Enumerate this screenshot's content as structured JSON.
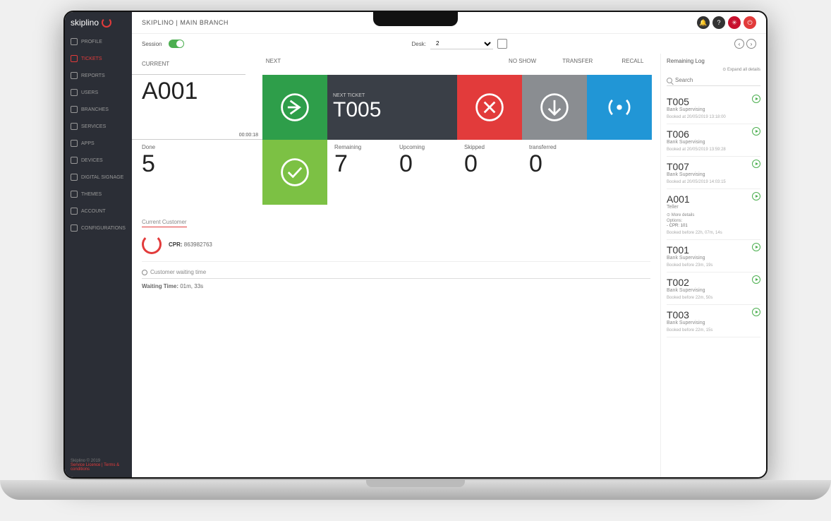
{
  "brand": "skiplino",
  "breadcrumb": "SKIPLINO | MAIN BRANCH",
  "sidebar": {
    "items": [
      {
        "label": "PROFILE"
      },
      {
        "label": "TICKETS"
      },
      {
        "label": "REPORTS"
      },
      {
        "label": "USERS"
      },
      {
        "label": "BRANCHES"
      },
      {
        "label": "SERVICES"
      },
      {
        "label": "APPS"
      },
      {
        "label": "DEVICES"
      },
      {
        "label": "DIGITAL SIGNAGE"
      },
      {
        "label": "THEMES"
      },
      {
        "label": "ACCOUNT"
      },
      {
        "label": "CONFIGURATIONS"
      }
    ],
    "footer": "Skiplino © 2019",
    "footer_links": "Service Licence | Terms & conditions"
  },
  "session": {
    "label": "Session",
    "desk_label": "Desk:",
    "desk_value": "2"
  },
  "headers": {
    "current": "CURRENT",
    "next": "NEXT",
    "noshow": "NO SHOW",
    "transfer": "TRANSFER",
    "recall": "RECALL",
    "next_ticket": "NEXT TICKET"
  },
  "current": {
    "value": "A001",
    "timer": "00:00:18"
  },
  "next_ticket": "T005",
  "stats": {
    "done_label": "Done",
    "done": "5",
    "remaining_label": "Remaining",
    "remaining": "7",
    "upcoming_label": "Upcoming",
    "upcoming": "0",
    "skipped_label": "Skipped",
    "skipped": "0",
    "transferred_label": "transferred",
    "transferred": "0"
  },
  "customer": {
    "section": "Current Customer",
    "cpr_label": "CPR:",
    "cpr": "863982763",
    "wait_section": "Customer waiting time",
    "wait_label": "Waiting Time:",
    "wait_value": "01m, 33s"
  },
  "remaining": {
    "title": "Remaining Log",
    "expand": "⊙ Expand all details",
    "search_placeholder": "Search",
    "cards": [
      {
        "num": "T005",
        "service": "Bank Supervising",
        "time": "Booked at 20/05/2019 13:18:00"
      },
      {
        "num": "T006",
        "service": "Bank Supervising",
        "time": "Booked at 20/05/2019 13:59:28"
      },
      {
        "num": "T007",
        "service": "Bank Supervising",
        "time": "Booked at 20/05/2019 14:03:15"
      },
      {
        "num": "A001",
        "service": "Teller",
        "details": "⊙ More details",
        "options": "Options:",
        "cpr": "- CPR: 101",
        "time": "Booked before 22h, 07m, 14s"
      },
      {
        "num": "T001",
        "service": "Bank Supervising",
        "time": "Booked before 23m, 19s"
      },
      {
        "num": "T002",
        "service": "Bank Supervising",
        "time": "Booked before 22m, 50s"
      },
      {
        "num": "T003",
        "service": "Bank Supervising",
        "time": "Booked before 22m, 15s"
      }
    ]
  }
}
